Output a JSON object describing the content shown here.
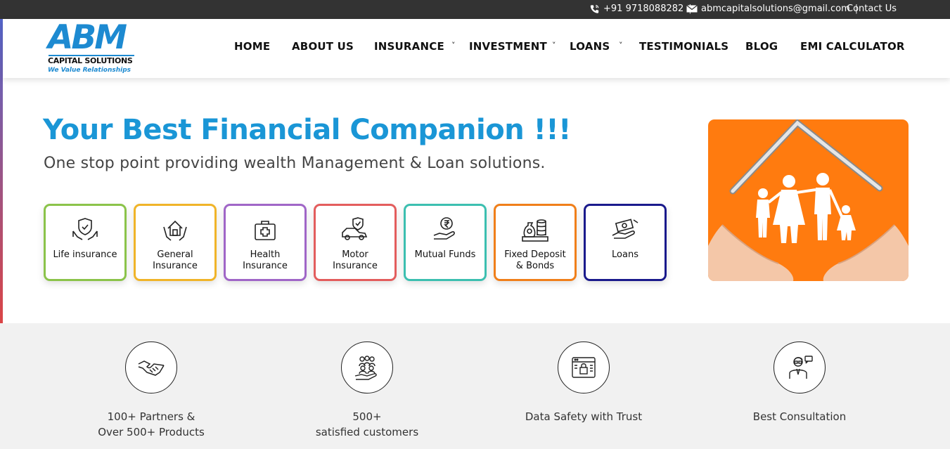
{
  "topbar": {
    "phone": "+91 9718088282",
    "email": "abmcapitalsolutions@gmail.com",
    "contact": "Contact Us",
    "separator": "|"
  },
  "logo": {
    "brand": "ABM",
    "company": "CAPITAL SOLUTIONS",
    "tagline": "We Value Relationships"
  },
  "nav": {
    "home": "HOME",
    "about": "ABOUT US",
    "insurance": "INSURANCE",
    "investment": "INVESTMENT",
    "loans": "LOANS",
    "testimonials": "TESTIMONIALS",
    "blog": "BLOG",
    "emi": "EMI CALCULATOR",
    "chevron": "˅"
  },
  "hero": {
    "title": "Your Best Financial Companion !!!",
    "subtitle": "One stop point providing wealth Management & Loan solutions."
  },
  "services": [
    {
      "line1": "Life insurance",
      "line2": "",
      "color": "#8bc34a",
      "icon": "shield-hands-icon"
    },
    {
      "line1": "General",
      "line2": "Insurance",
      "color": "#f0b429",
      "icon": "house-hands-icon"
    },
    {
      "line1": "Health",
      "line2": "Insurance",
      "color": "#a066c7",
      "icon": "medical-kit-icon"
    },
    {
      "line1": "Motor",
      "line2": "Insurance",
      "color": "#e35d5d",
      "icon": "car-shield-icon"
    },
    {
      "line1": "Mutual Funds",
      "line2": "",
      "color": "#3cbfb0",
      "icon": "rupee-hand-icon"
    },
    {
      "line1": "Fixed Deposit",
      "line2": "& Bonds",
      "color": "#f07f1a",
      "icon": "money-bag-icon"
    },
    {
      "line1": "Loans",
      "line2": "",
      "color": "#1a1a8c",
      "icon": "cash-hand-icon"
    }
  ],
  "stats": [
    {
      "line1": "100+ Partners &",
      "line2": "Over 500+ Products",
      "icon": "handshake-icon"
    },
    {
      "line1": "500+",
      "line2": "satisfied customers",
      "icon": "customers-icon"
    },
    {
      "line1": "Data Safety with Trust",
      "line2": "",
      "icon": "secure-browser-icon"
    },
    {
      "line1": "Best Consultation",
      "line2": "",
      "icon": "consultant-icon"
    }
  ],
  "colors": {
    "accent": "#1a96d6",
    "topbar": "#333333",
    "hero_image_bg": "#ff7b0f",
    "stats_bg": "#f1f1f1"
  }
}
